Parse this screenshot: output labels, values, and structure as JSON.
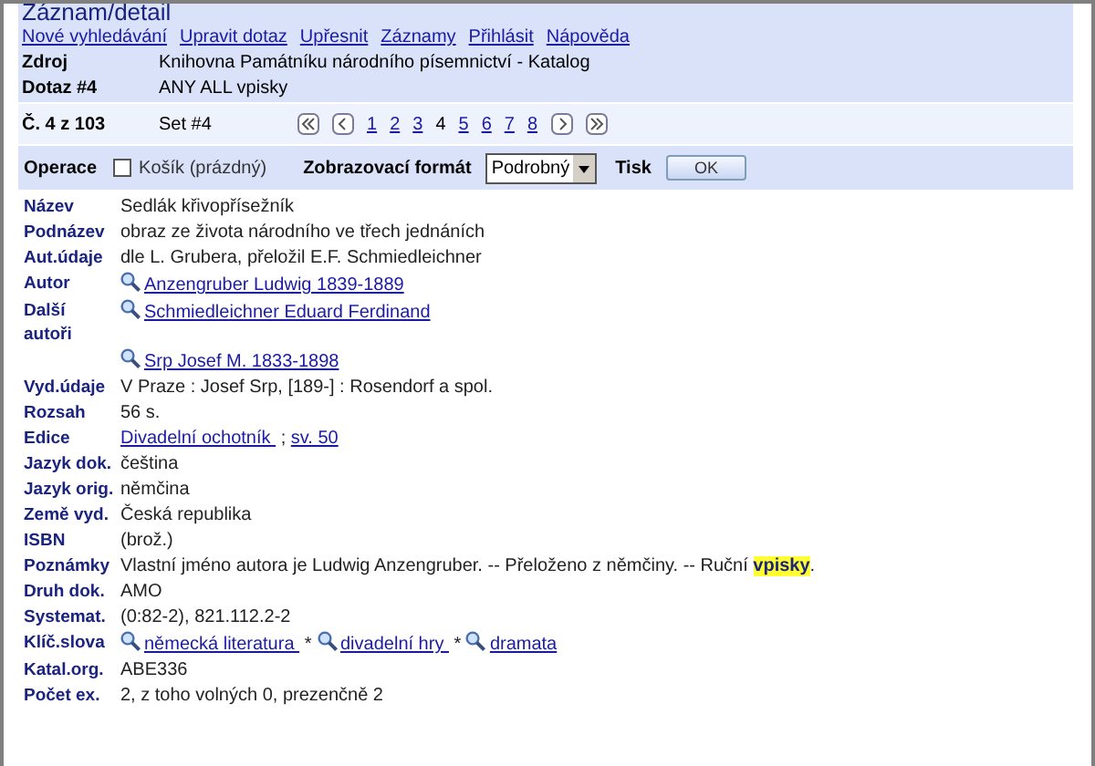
{
  "title": "Záznam/detail",
  "menu": [
    "Nové vyhledávání",
    "Upravit dotaz",
    "Upřesnit",
    "Záznamy",
    "Přihlásit",
    "Nápověda"
  ],
  "info": [
    {
      "label": "Zdroj",
      "value": "Knihovna Památníku národního písemnictví - Katalog"
    },
    {
      "label": "Dotaz #4",
      "value": "ANY ALL vpisky"
    }
  ],
  "record_position": "Č. 4 z 103",
  "set": "Set #4",
  "pager": [
    {
      "kind": "first"
    },
    {
      "kind": "prev"
    },
    {
      "kind": "page",
      "text": "1",
      "selected": false
    },
    {
      "kind": "page",
      "text": "2",
      "selected": false
    },
    {
      "kind": "page",
      "text": "3",
      "selected": false
    },
    {
      "kind": "page",
      "text": "4",
      "selected": true
    },
    {
      "kind": "page",
      "text": "5",
      "selected": false
    },
    {
      "kind": "page",
      "text": "6",
      "selected": false
    },
    {
      "kind": "page",
      "text": "7",
      "selected": false
    },
    {
      "kind": "page",
      "text": "8",
      "selected": false
    },
    {
      "kind": "next"
    },
    {
      "kind": "last"
    }
  ],
  "operations": {
    "label": "Operace",
    "basket": {
      "label": "Košík (prázdný)",
      "checked": false
    },
    "format_label": "Zobrazovací formát",
    "format": "Podrobný",
    "print_label": "Tisk",
    "ok": "OK"
  },
  "fields": [
    {
      "label": "Název",
      "parts": [
        {
          "kind": "text",
          "text": "Sedlák křivopřísežník"
        }
      ]
    },
    {
      "label": "Podnázev",
      "parts": [
        {
          "kind": "text",
          "text": "obraz ze života národního ve třech jednáních"
        }
      ]
    },
    {
      "label": "Aut.údaje",
      "parts": [
        {
          "kind": "text",
          "text": "dle L. Grubera, přeložil E.F. Schmiedleichner"
        }
      ]
    },
    {
      "label": "Autor",
      "parts": [
        {
          "kind": "search",
          "text": "Anzengruber Ludwig 1839-1889"
        }
      ]
    },
    {
      "label": "Další autoři",
      "parts": [
        {
          "kind": "search",
          "text": "Schmiedleichner Eduard Ferdinand"
        }
      ]
    },
    {
      "parts": [
        {
          "kind": "search",
          "text": "Srp Josef M. 1833-1898"
        }
      ]
    },
    {
      "label": "Vyd.údaje",
      "parts": [
        {
          "kind": "text",
          "text": "V Praze : Josef Srp, [189-] : Rosendorf a spol."
        }
      ]
    },
    {
      "label": "Rozsah",
      "parts": [
        {
          "kind": "text",
          "text": "56 s."
        }
      ]
    },
    {
      "label": "Edice",
      "parts": [
        {
          "kind": "link",
          "text": "Divadelní ochotník "
        },
        {
          "kind": "text",
          "text": " ; "
        },
        {
          "kind": "link",
          "text": "sv. 50"
        }
      ]
    },
    {
      "label": "Jazyk dok.",
      "parts": [
        {
          "kind": "text",
          "text": "čeština"
        }
      ]
    },
    {
      "label": "Jazyk orig.",
      "parts": [
        {
          "kind": "text",
          "text": "němčina"
        }
      ]
    },
    {
      "label": "Země vyd.",
      "parts": [
        {
          "kind": "text",
          "text": "Česká republika"
        }
      ]
    },
    {
      "label": "ISBN",
      "parts": [
        {
          "kind": "text",
          "text": "(brož.)"
        }
      ]
    },
    {
      "label": "Poznámky",
      "parts": [
        {
          "kind": "text",
          "text": "Vlastní jméno autora je Ludwig Anzengruber. -- Přeloženo z němčiny. -- Ruční "
        },
        {
          "kind": "highlight",
          "text": "vpisky"
        },
        {
          "kind": "text",
          "text": "."
        }
      ]
    },
    {
      "label": "Druh dok.",
      "parts": [
        {
          "kind": "text",
          "text": "AMO"
        }
      ]
    },
    {
      "label": "Systemat.",
      "parts": [
        {
          "kind": "text",
          "text": "(0:82-2), 821.112.2-2"
        }
      ]
    },
    {
      "label": "Klíč.slova",
      "parts": [
        {
          "kind": "search",
          "text": "německá literatura "
        },
        {
          "kind": "text",
          "text": " * "
        },
        {
          "kind": "search",
          "text": "divadelní hry "
        },
        {
          "kind": "text",
          "text": " * "
        },
        {
          "kind": "search",
          "text": "dramata"
        }
      ]
    },
    {
      "label": "Katal.org.",
      "parts": [
        {
          "kind": "text",
          "text": "ABE336"
        }
      ]
    },
    {
      "label": "Počet ex.",
      "parts": [
        {
          "kind": "text",
          "text": "2, z toho volných 0, prezenčně 2"
        }
      ]
    }
  ]
}
